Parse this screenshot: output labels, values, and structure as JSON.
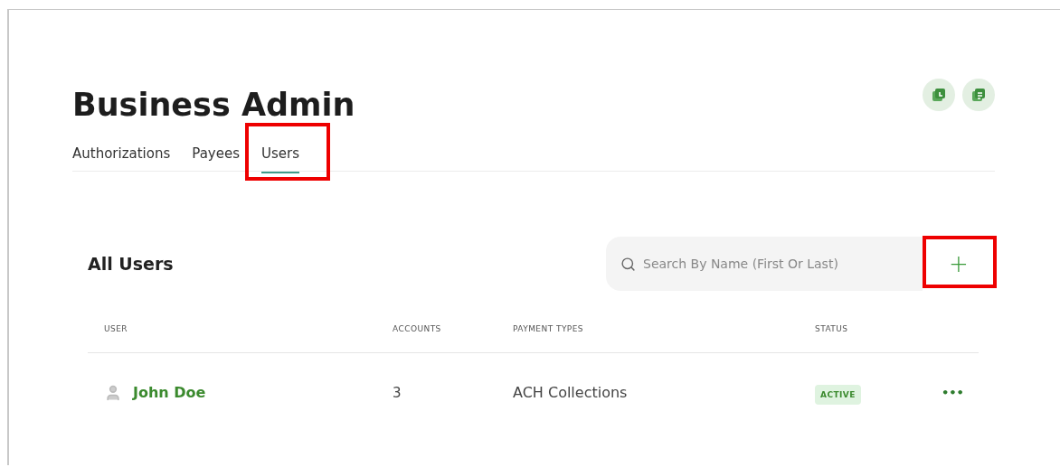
{
  "page": {
    "title": "Business Admin"
  },
  "header_buttons": [
    {
      "kind": "clock"
    },
    {
      "kind": "note"
    }
  ],
  "tabs": [
    {
      "label": "Authorizations",
      "selected": false,
      "highlighted": false
    },
    {
      "label": "Payees",
      "selected": false,
      "highlighted": false
    },
    {
      "label": "Users",
      "selected": true,
      "highlighted": true
    }
  ],
  "section": {
    "title": "All Users",
    "search": {
      "placeholder": "Search By Name (First Or Last)"
    },
    "add_button": {
      "label": "+",
      "highlighted": true
    }
  },
  "table": {
    "columns": [
      "USER",
      "ACCOUNTS",
      "PAYMENT TYPES",
      "STATUS"
    ],
    "rows": [
      {
        "user": "John Doe",
        "accounts": "3",
        "payment_types": "ACH Collections",
        "status": "ACTIVE",
        "menu": "•••"
      }
    ]
  }
}
